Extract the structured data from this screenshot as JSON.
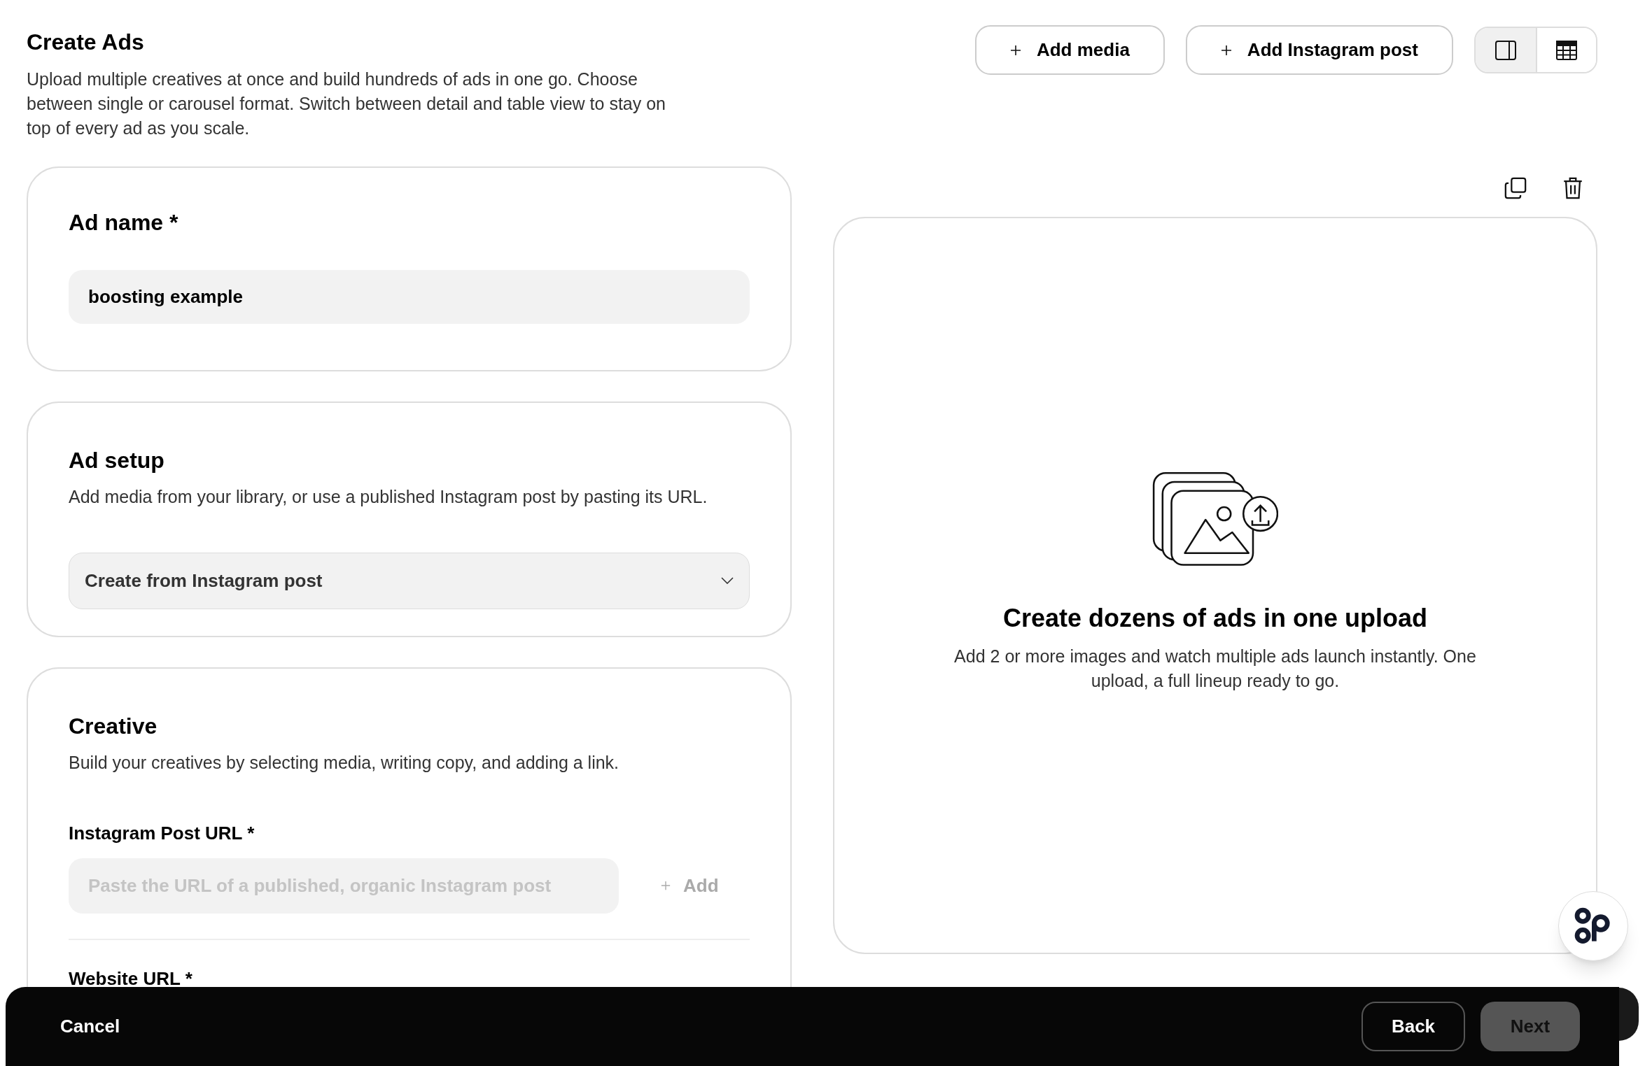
{
  "header": {
    "title": "Create Ads",
    "description": "Upload multiple creatives at once and build hundreds of ads in one go. Choose between single or carousel format. Switch between detail and table view to stay on top of every ad as you scale."
  },
  "toolbar": {
    "buttons": [
      {
        "label": "Add media"
      },
      {
        "label": "Add Instagram post"
      }
    ],
    "views": [
      {
        "kind": "detail",
        "selected": true
      },
      {
        "kind": "table",
        "selected": false
      }
    ]
  },
  "sections": [
    {
      "kind": "name",
      "title": "Ad name *",
      "value": "boosting example"
    },
    {
      "kind": "setup",
      "title": "Ad setup",
      "description": "Add media from your library, or use a published Instagram post by pasting its URL.",
      "select": "Create from Instagram post"
    },
    {
      "kind": "creative",
      "title": "Creative",
      "description": "Build your creatives by selecting media, writing copy, and adding a link.",
      "fields": [
        {
          "label": "Instagram Post URL *",
          "placeholder": "Paste the URL of a published, organic Instagram post",
          "action": {
            "label": "Add",
            "disabled": true
          }
        },
        {
          "label": "Website URL *"
        }
      ]
    }
  ],
  "preview": {
    "title": "Create dozens of ads in one upload",
    "description": "Add 2 or more images and watch multiple ads launch instantly. One upload, a full lineup ready to go."
  },
  "footer": {
    "cancel": "Cancel",
    "back": "Back",
    "next": {
      "label": "Next",
      "disabled": true
    }
  }
}
